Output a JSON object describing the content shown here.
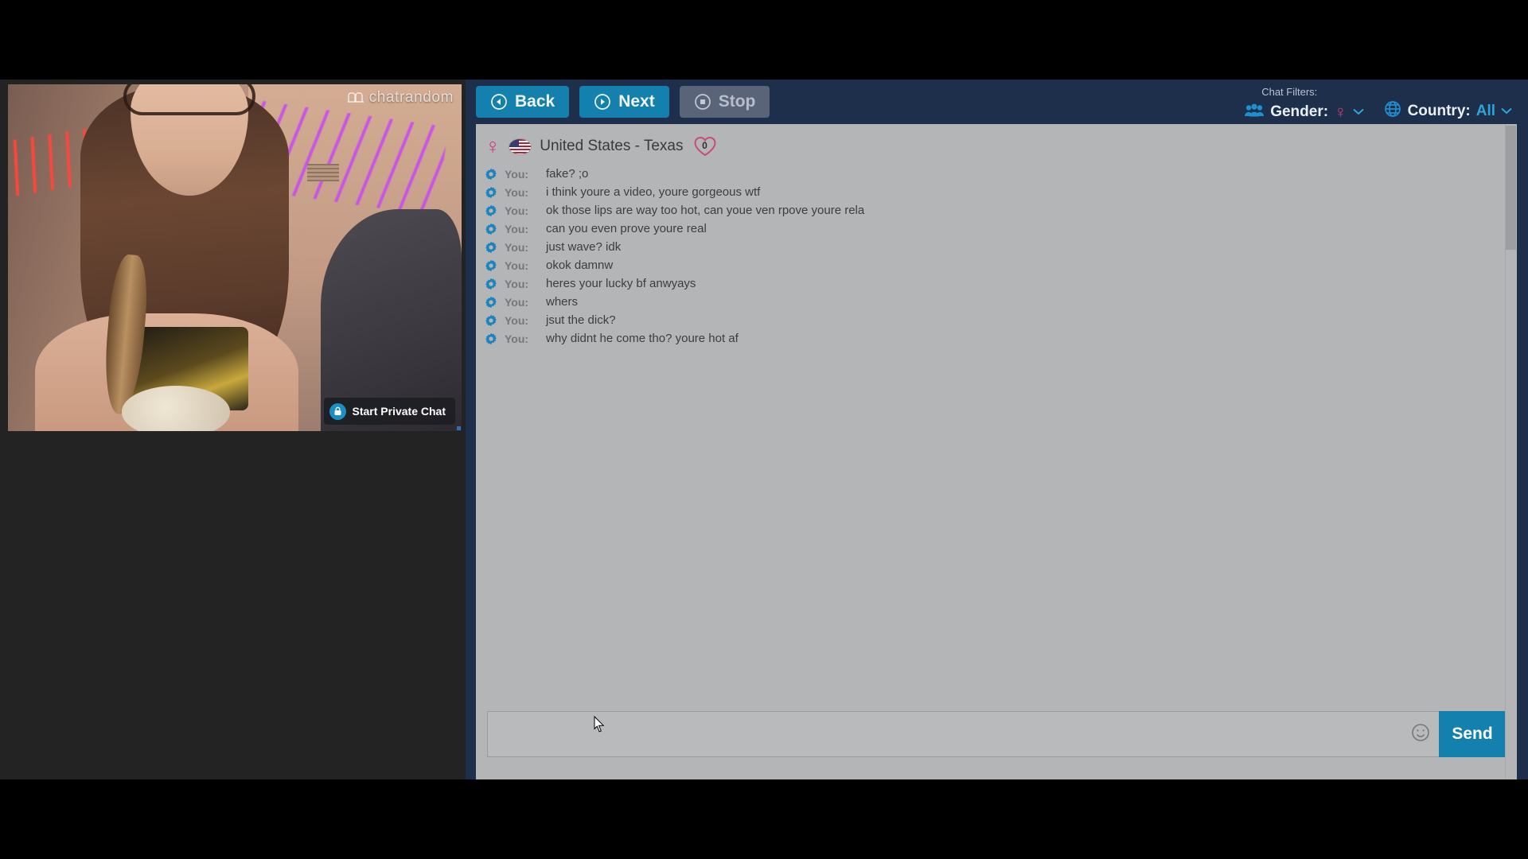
{
  "app": {
    "watermark": "chatrandom",
    "watermark_icon": "chatrandom-logo-icon"
  },
  "video": {
    "private_chat_label": "Start Private Chat",
    "lock_icon": "lock-icon",
    "resize_handle": "resize-handle"
  },
  "toolbar": {
    "back_label": "Back",
    "next_label": "Next",
    "stop_label": "Stop",
    "back_icon": "play-back-circle-icon",
    "next_icon": "play-forward-circle-icon",
    "stop_icon": "stop-circle-icon",
    "stop_disabled": true
  },
  "filters": {
    "title": "Chat Filters:",
    "gender": {
      "icon": "people-group-icon",
      "label": "Gender:",
      "value": "♀",
      "caret": "⌄"
    },
    "country": {
      "icon": "globe-icon",
      "label": "Country:",
      "value": "All",
      "caret": "⌄"
    }
  },
  "peer": {
    "gender_symbol": "♀",
    "flag_icon": "united-states-flag-icon",
    "location": "United States - Texas",
    "favorite_icon": "heart-icon",
    "favorite_count": "0"
  },
  "chat": {
    "sender_label": "You:",
    "sender_icon": "gear-bullet-icon",
    "messages": [
      {
        "who": "You:",
        "text": "fake? ;o"
      },
      {
        "who": "You:",
        "text": "i think youre a video, youre gorgeous wtf"
      },
      {
        "who": "You:",
        "text": "ok those lips are way too hot, can youe ven rpove youre rela"
      },
      {
        "who": "You:",
        "text": "can you even prove youre real"
      },
      {
        "who": "You:",
        "text": "just wave? idk"
      },
      {
        "who": "You:",
        "text": "okok damnw"
      },
      {
        "who": "You:",
        "text": "heres your lucky bf anwyays"
      },
      {
        "who": "You:",
        "text": "whers"
      },
      {
        "who": "You:",
        "text": "jsut the dick?"
      },
      {
        "who": "You:",
        "text": "why didnt he come tho? youre hot af"
      }
    ]
  },
  "composer": {
    "value": "",
    "placeholder": "",
    "emoji_icon": "smiley-face-icon",
    "send_label": "Send"
  },
  "colors": {
    "accent_blue": "#1480ad",
    "header_navy": "#1d2f4a",
    "chat_bg": "#b4b5b7",
    "disabled_gray": "#5a6478",
    "pink": "#d1387a",
    "link_blue": "#2aa6d8"
  }
}
